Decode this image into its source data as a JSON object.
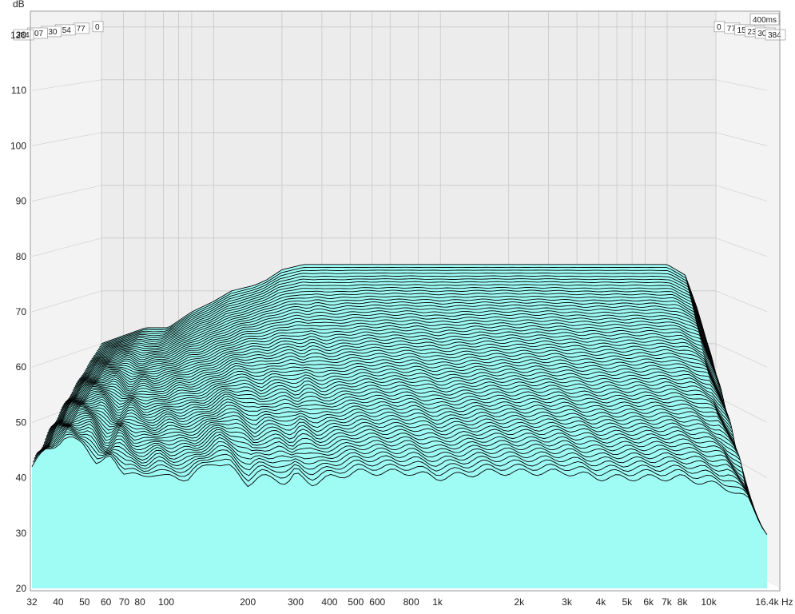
{
  "chart_data": {
    "type": "area",
    "subtype": "cumulative-spectral-decay-waterfall",
    "ylabel": "dB",
    "xunit": "Hz",
    "x_scale": "log",
    "xlim": [
      32,
      16400
    ],
    "ylim": [
      20,
      123
    ],
    "x_ticks": [
      "32",
      "40",
      "50",
      "60",
      "70",
      "80",
      "100",
      "200",
      "300",
      "400",
      "500",
      "600",
      "800",
      "1k",
      "2k",
      "3k",
      "4k",
      "5k",
      "6k",
      "7k",
      "8k",
      "10k",
      "16.4k"
    ],
    "x_tick_values": [
      32,
      40,
      50,
      60,
      70,
      80,
      100,
      200,
      300,
      400,
      500,
      600,
      800,
      1000,
      2000,
      3000,
      4000,
      5000,
      6000,
      7000,
      8000,
      10000,
      16400
    ],
    "y_ticks": [
      20,
      30,
      40,
      50,
      60,
      70,
      80,
      90,
      100,
      110,
      120
    ],
    "time_axis_label": "400ms",
    "time_labels": [
      "0",
      "77",
      "154",
      "230",
      "307",
      "384"
    ],
    "slice_count": 64,
    "fill_color": "#9ffcf5",
    "edge_color": "#000000",
    "back_wall_color": "#ececec",
    "grid": true,
    "front_slice": {
      "freq": [
        32,
        36,
        42,
        50,
        56,
        63,
        70,
        80,
        90,
        100,
        110,
        120,
        130,
        150,
        170,
        200,
        220,
        250,
        280,
        300,
        350,
        400,
        500,
        600,
        800,
        1000,
        1500,
        2000,
        3000,
        4000,
        5000,
        6000,
        8000,
        10000,
        12000,
        14000,
        16400
      ],
      "level": [
        42,
        45,
        47,
        46.5,
        42,
        44,
        41,
        40,
        41,
        40,
        40,
        40,
        41,
        43,
        42,
        39,
        40,
        40,
        39,
        40.5,
        39,
        40,
        41,
        41,
        41,
        40,
        41,
        41,
        41,
        40,
        40,
        40,
        40,
        39,
        38,
        36,
        30
      ]
    },
    "back_slice": {
      "freq": [
        32,
        50,
        63,
        80,
        100,
        120,
        150,
        170,
        200,
        250,
        300,
        400,
        500,
        600,
        800,
        1000,
        2000,
        3000,
        5000,
        8000,
        10000,
        12000,
        14000,
        16400
      ],
      "level": [
        60,
        63,
        63,
        66,
        68,
        70,
        71,
        72,
        74,
        75,
        75,
        75,
        75,
        75,
        75,
        75,
        75,
        75,
        75,
        75,
        75,
        73,
        65,
        22
      ]
    },
    "decay_db_total": 27
  }
}
